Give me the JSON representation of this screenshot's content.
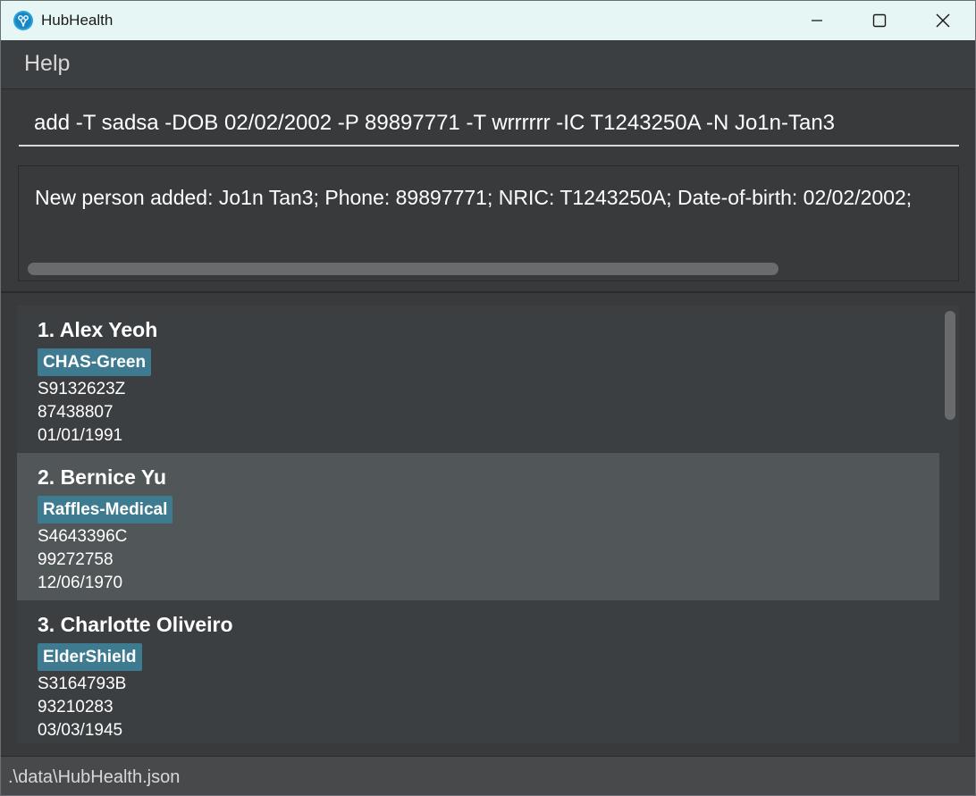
{
  "window": {
    "title": "HubHealth",
    "controls": {
      "minimize_icon": "minimize-icon",
      "maximize_icon": "maximize-icon",
      "close_icon": "close-icon"
    }
  },
  "menu": {
    "items": [
      "Help"
    ]
  },
  "command": {
    "value": "add -T sadsa -DOB 02/02/2002 -P 89897771 -T wrrrrrr -IC T1243250A -N Jo1n-Tan3"
  },
  "result": {
    "text": "New person added: Jo1n Tan3; Phone: 89897771; NRIC: T1243250A; Date-of-birth: 02/02/2002;"
  },
  "persons": [
    {
      "name": "1. Alex Yeoh",
      "tag": "CHAS-Green",
      "nric": "S9132623Z",
      "phone": "87438807",
      "dob": "01/01/1991"
    },
    {
      "name": "2. Bernice Yu",
      "tag": "Raffles-Medical",
      "nric": "S4643396C",
      "phone": "99272758",
      "dob": "12/06/1970"
    },
    {
      "name": "3. Charlotte Oliveiro",
      "tag": "ElderShield",
      "nric": "S3164793B",
      "phone": "93210283",
      "dob": "03/03/1945"
    }
  ],
  "status": {
    "file_path": ".\\data\\HubHealth.json"
  },
  "colors": {
    "titlebar_bg": "#e6f6f5",
    "window_bg": "#383a3c",
    "selected_card": "#515658",
    "tag_bg": "#3e7b91"
  }
}
